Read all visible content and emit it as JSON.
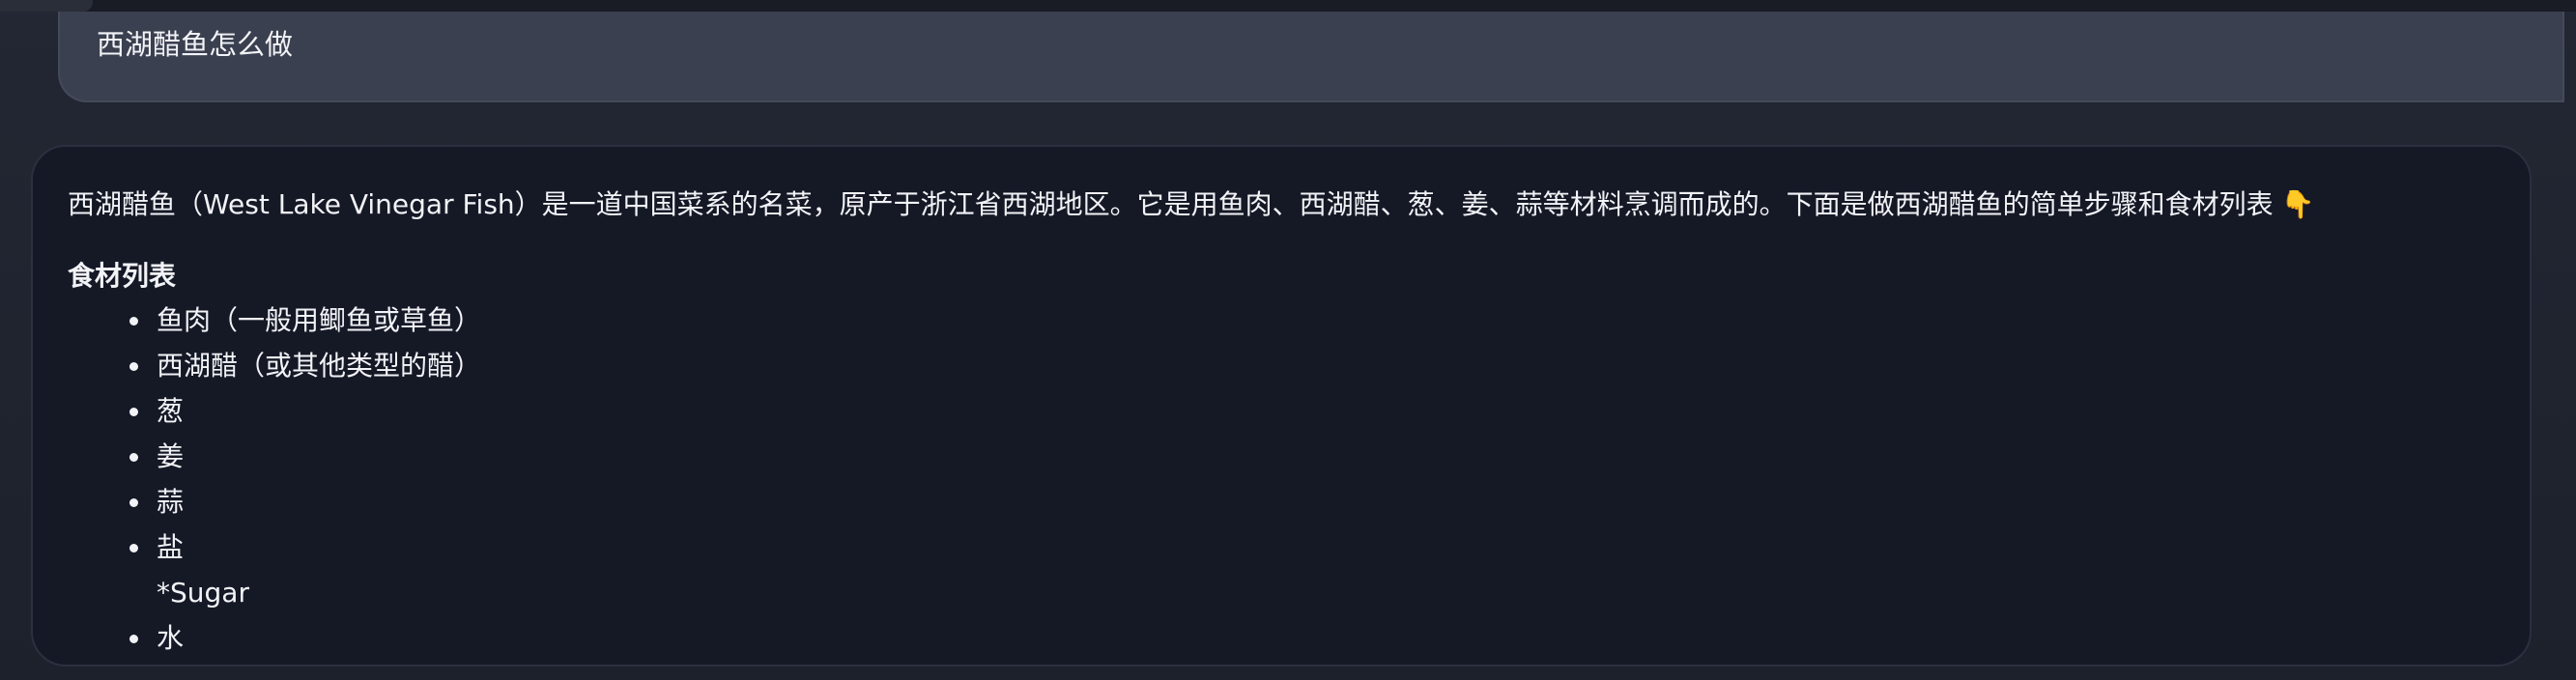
{
  "user_message": {
    "text": "西湖醋鱼怎么做"
  },
  "bot_message": {
    "intro": "西湖醋鱼（West Lake Vinegar Fish）是一道中国菜系的名菜，原产于浙江省西湖地区。它是用鱼肉、西湖醋、葱、姜、蒜等材料烹调而成的。下面是做西湖醋鱼的简单步骤和食材列表",
    "intro_emoji": "👇",
    "ingredients_heading": "食材列表",
    "ingredients": [
      {
        "label": "鱼肉（一般用鲫鱼或草鱼）",
        "bulleted": true
      },
      {
        "label": "西湖醋（或其他类型的醋）",
        "bulleted": true
      },
      {
        "label": "葱",
        "bulleted": true
      },
      {
        "label": "姜",
        "bulleted": true
      },
      {
        "label": "蒜",
        "bulleted": true
      },
      {
        "label": "盐",
        "bulleted": true
      },
      {
        "label": "*Sugar",
        "bulleted": false
      },
      {
        "label": "水",
        "bulleted": true
      }
    ]
  },
  "colors": {
    "background": "#1f2430",
    "user_bubble": "#3b4050",
    "bot_bubble": "#151926",
    "text": "#f2f3f7"
  }
}
